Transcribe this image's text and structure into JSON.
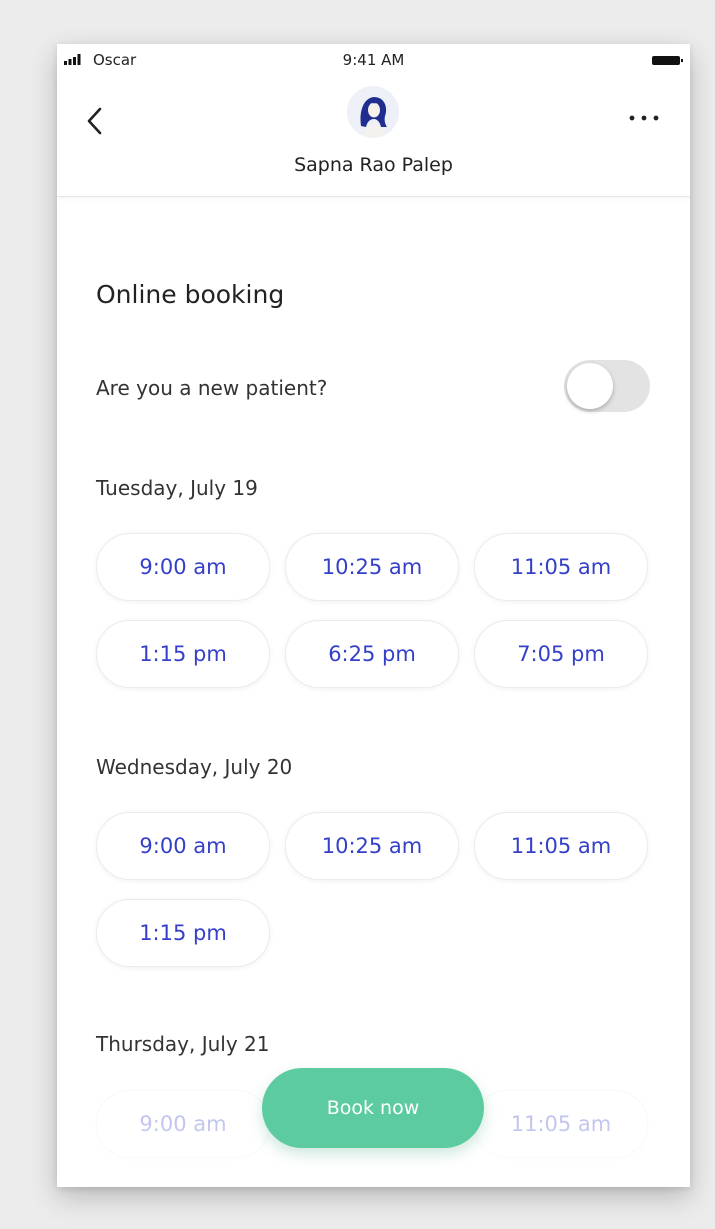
{
  "status_bar": {
    "carrier": "Oscar",
    "time": "9:41 AM"
  },
  "header": {
    "provider_name": "Sapna Rao Palep",
    "back_icon": "chevron-left-icon",
    "more_icon": "more-horizontal-icon"
  },
  "booking": {
    "title": "Online booking",
    "new_patient_question": "Are you a new patient?",
    "new_patient_toggle": false,
    "days": [
      {
        "label": "Tuesday, July 19",
        "slots": [
          "9:00 am",
          "10:25 am",
          "11:05 am",
          "1:15 pm",
          "6:25 pm",
          "7:05 pm"
        ]
      },
      {
        "label": "Wednesday, July 20",
        "slots": [
          "9:00 am",
          "10:25 am",
          "11:05 am",
          "1:15 pm"
        ]
      },
      {
        "label": "Thursday, July 21",
        "slots": [
          "9:00 am",
          "11:05 am"
        ]
      }
    ],
    "book_button": "Book now"
  },
  "colors": {
    "accent_blue": "#3540c8",
    "book_green": "#5ccca0"
  }
}
